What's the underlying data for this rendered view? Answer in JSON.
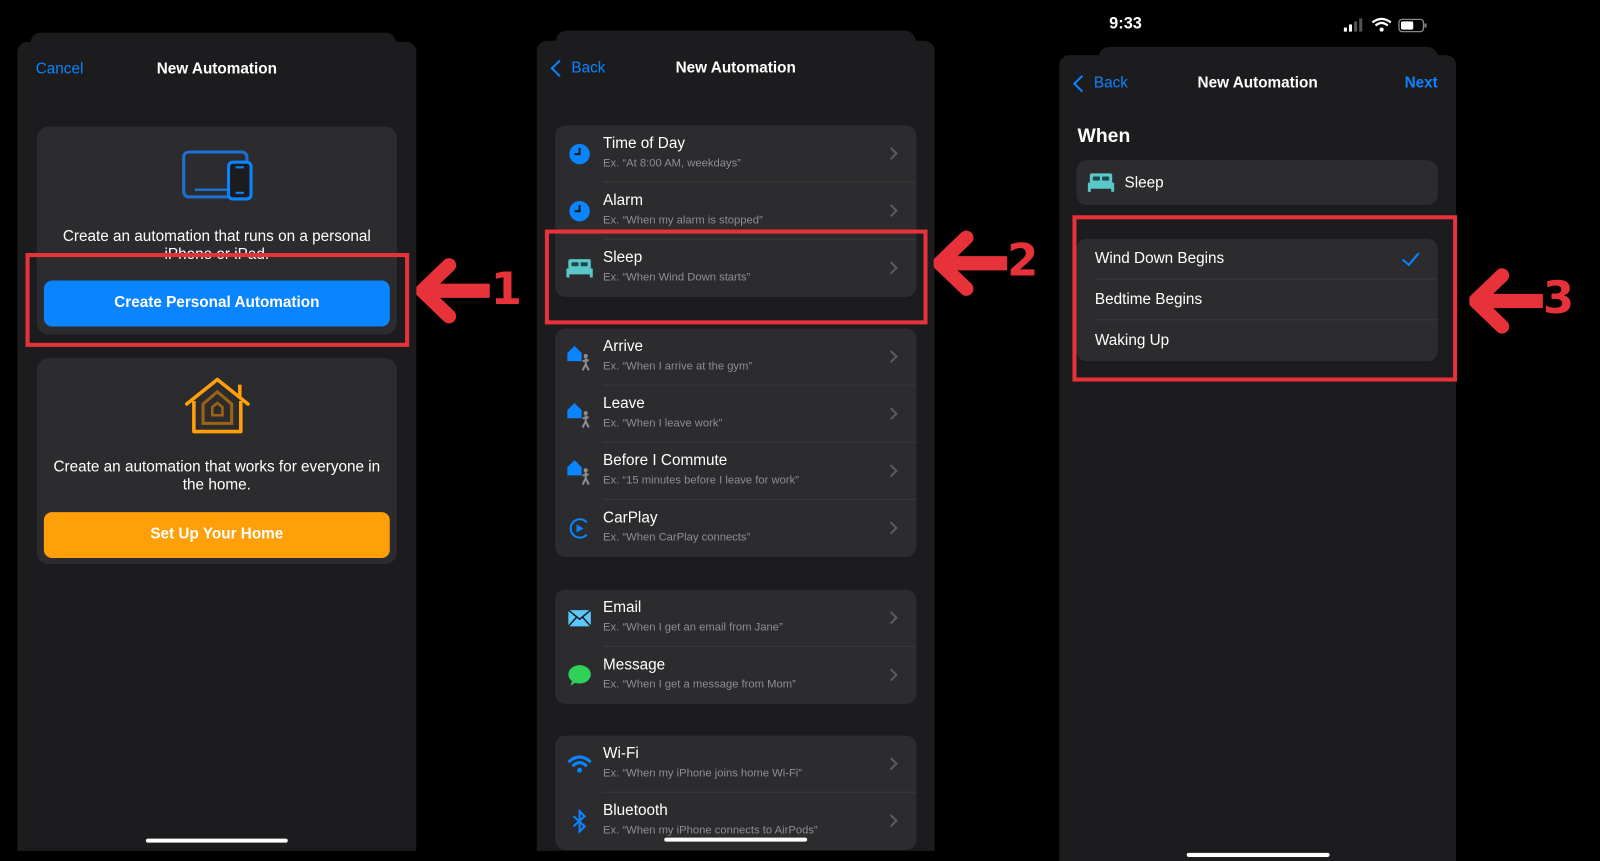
{
  "panel1": {
    "nav": {
      "cancel": "Cancel",
      "title": "New Automation"
    },
    "personal": {
      "description": "Create an automation that runs on a personal iPhone or iPad.",
      "button": "Create Personal Automation",
      "icon": "devices-icon",
      "button_color": "#0a84ff"
    },
    "home": {
      "description": "Create an automation that works for everyone in the home.",
      "button": "Set Up Your Home",
      "icon": "home-icon",
      "button_color": "#ff9f0a"
    },
    "annotation": "1"
  },
  "panel2": {
    "nav": {
      "back": "Back",
      "title": "New Automation"
    },
    "groups": [
      {
        "items": [
          {
            "title": "Time of Day",
            "subtitle": "Ex. “At 8:00 AM, weekdays”",
            "icon": "clock-icon"
          },
          {
            "title": "Alarm",
            "subtitle": "Ex. “When my alarm is stopped”",
            "icon": "clock-icon"
          },
          {
            "title": "Sleep",
            "subtitle": "Ex. “When Wind Down starts”",
            "icon": "bed-icon"
          }
        ]
      },
      {
        "items": [
          {
            "title": "Arrive",
            "subtitle": "Ex. “When I arrive at the gym”",
            "icon": "location-person-icon"
          },
          {
            "title": "Leave",
            "subtitle": "Ex. “When I leave work”",
            "icon": "location-person-icon"
          },
          {
            "title": "Before I Commute",
            "subtitle": "Ex. “15 minutes before I leave for work”",
            "icon": "location-person-icon"
          },
          {
            "title": "CarPlay",
            "subtitle": "Ex. “When CarPlay connects”",
            "icon": "carplay-icon"
          }
        ]
      },
      {
        "items": [
          {
            "title": "Email",
            "subtitle": "Ex. “When I get an email from Jane”",
            "icon": "mail-icon"
          },
          {
            "title": "Message",
            "subtitle": "Ex. “When I get a message from Mom”",
            "icon": "message-icon"
          }
        ]
      },
      {
        "items": [
          {
            "title": "Wi-Fi",
            "subtitle": "Ex. “When my iPhone joins home Wi-Fi”",
            "icon": "wifi-icon"
          },
          {
            "title": "Bluetooth",
            "subtitle": "Ex. “When my iPhone connects to AirPods”",
            "icon": "bluetooth-icon"
          }
        ]
      }
    ],
    "annotation": "2"
  },
  "panel3": {
    "status": {
      "time": "9:33"
    },
    "nav": {
      "back": "Back",
      "title": "New Automation",
      "next": "Next"
    },
    "section_title": "When",
    "trigger": "Sleep",
    "options": [
      {
        "label": "Wind Down Begins",
        "selected": true
      },
      {
        "label": "Bedtime Begins",
        "selected": false
      },
      {
        "label": "Waking Up",
        "selected": false
      }
    ],
    "annotation": "3"
  },
  "colors": {
    "accent": "#0a84ff",
    "annotation": "#e8323a",
    "sleep_teal": "#5ac8c8"
  }
}
